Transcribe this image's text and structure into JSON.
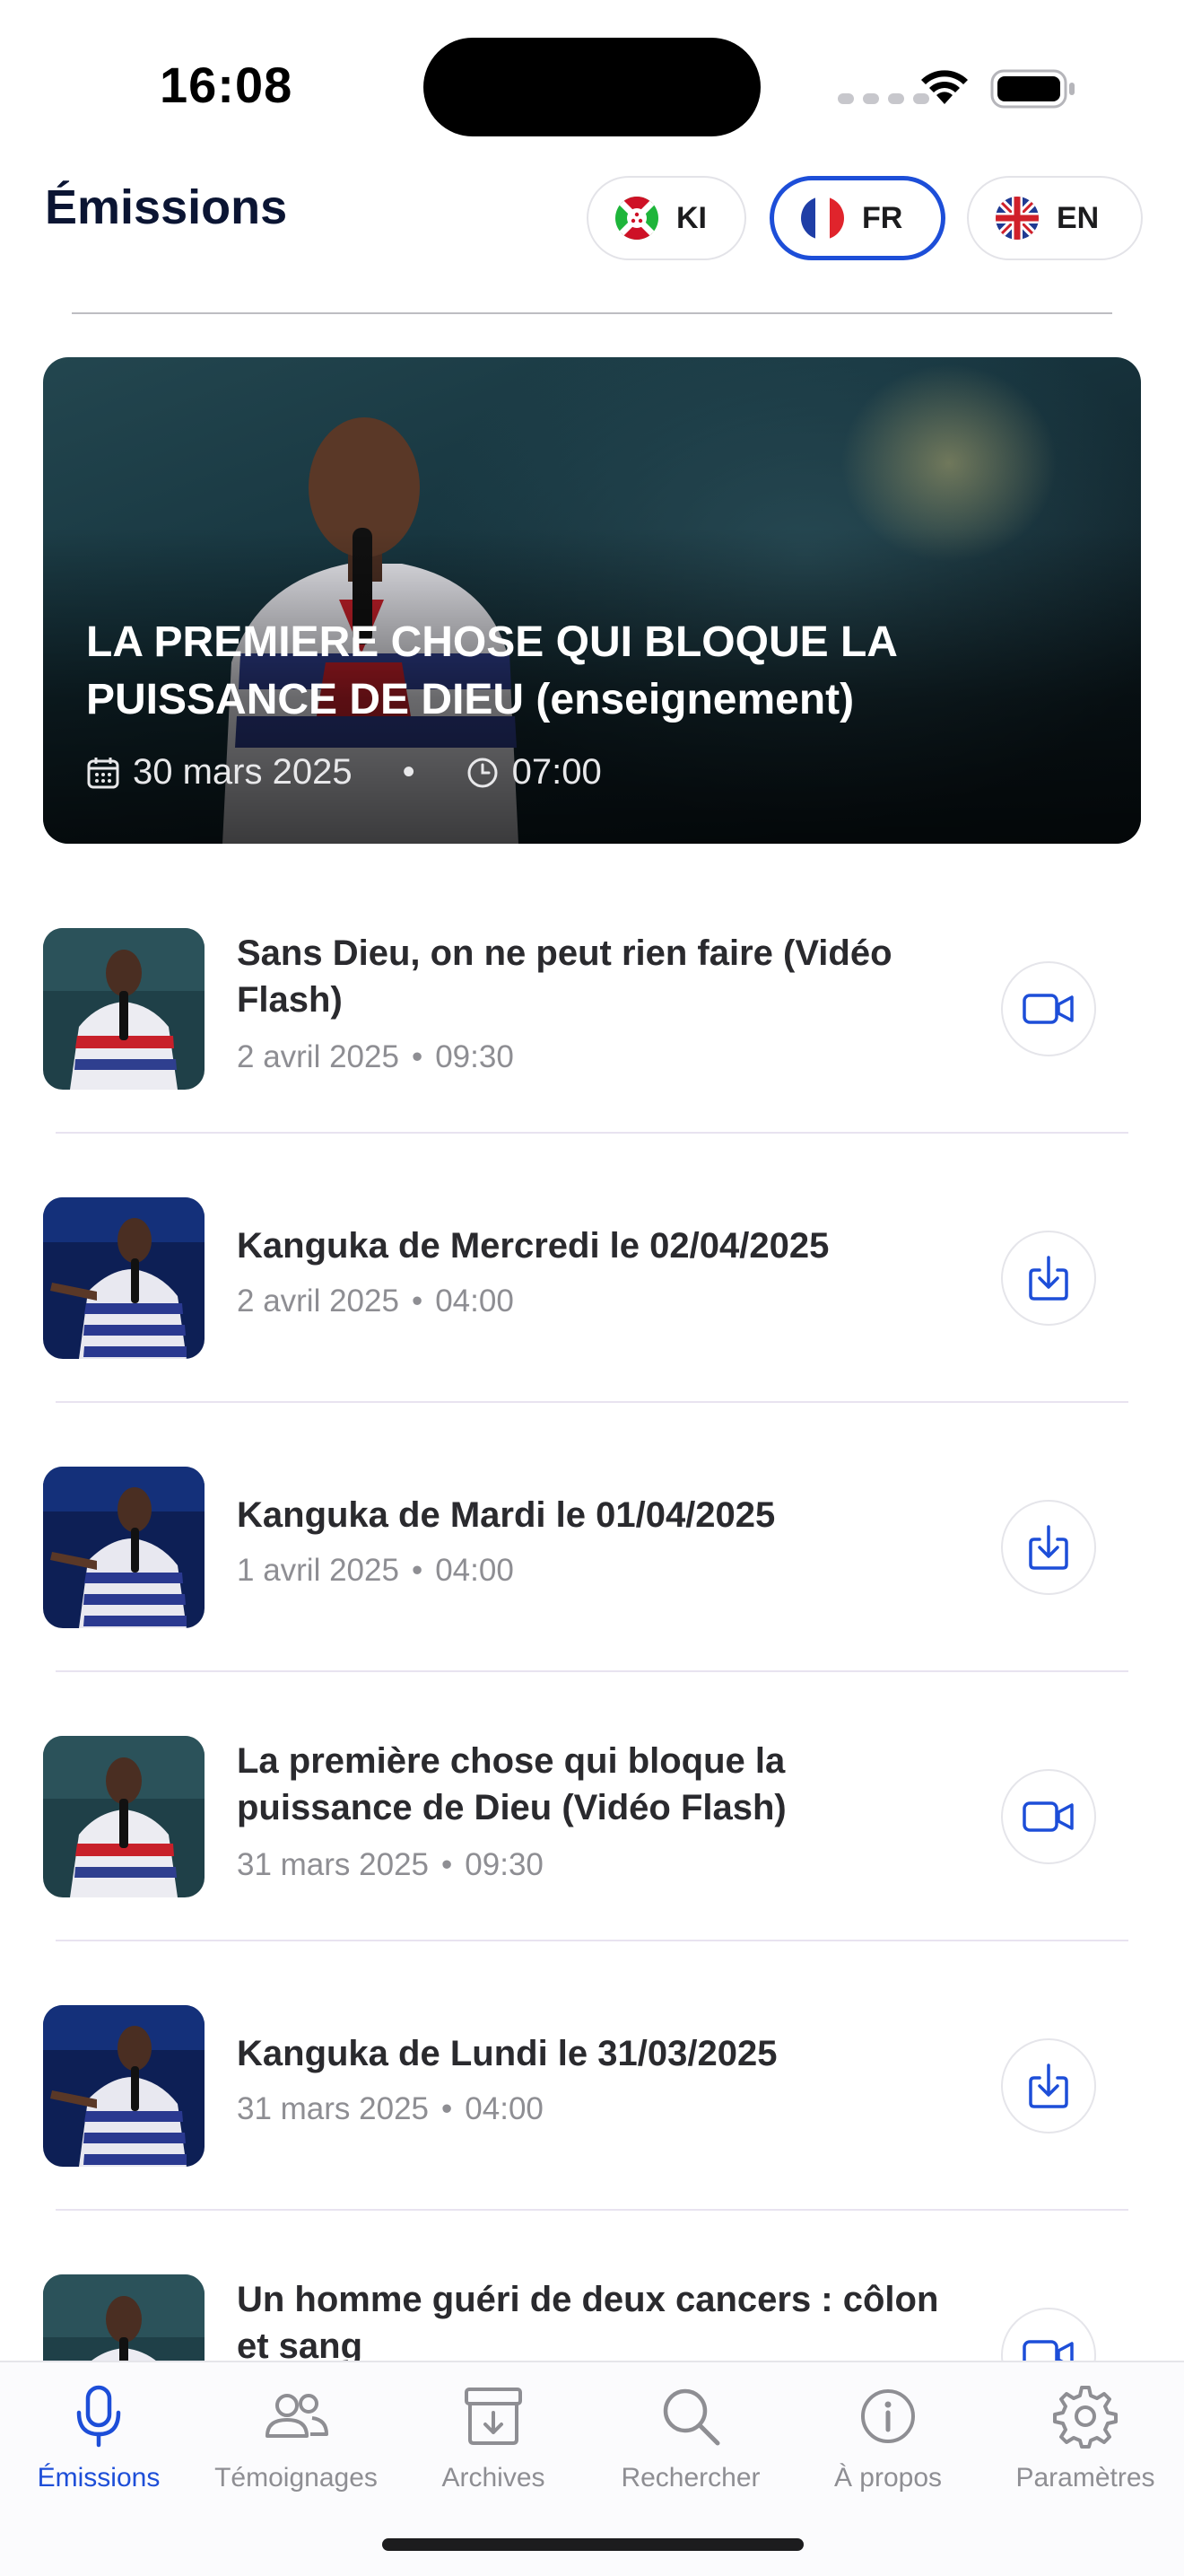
{
  "status_bar": {
    "time": "16:08"
  },
  "header": {
    "title": "Émissions",
    "languages": [
      {
        "code": "KI",
        "flag": "burundi-flag",
        "active": false
      },
      {
        "code": "FR",
        "flag": "france-flag",
        "active": true
      },
      {
        "code": "EN",
        "flag": "uk-flag",
        "active": false
      }
    ]
  },
  "hero": {
    "title": "LA PREMIERE CHOSE QUI BLOQUE LA PUISSANCE DE DIEU (enseignement)",
    "date": "30 mars 2025",
    "time": "07:00"
  },
  "episodes": [
    {
      "title": "Sans Dieu, on ne peut rien faire (Vidéo Flash)",
      "date": "2 avril 2025",
      "time": "09:30",
      "action": "video-icon"
    },
    {
      "title": "Kanguka de Mercredi le 02/04/2025",
      "date": "2 avril 2025",
      "time": "04:00",
      "action": "download-icon"
    },
    {
      "title": "Kanguka de Mardi le 01/04/2025",
      "date": "1 avril 2025",
      "time": "04:00",
      "action": "download-icon"
    },
    {
      "title": "La première chose qui bloque la puissance de Dieu (Vidéo Flash)",
      "date": "31 mars 2025",
      "time": "09:30",
      "action": "video-icon"
    },
    {
      "title": "Kanguka de Lundi le 31/03/2025",
      "date": "31 mars 2025",
      "time": "04:00",
      "action": "download-icon"
    },
    {
      "title": "Un homme guéri de deux cancers : côlon et sang",
      "date": "",
      "time": "",
      "action": "video-icon"
    }
  ],
  "meta_separator": "•",
  "tabs": [
    {
      "label": "Émissions",
      "icon": "microphone-icon",
      "active": true
    },
    {
      "label": "Témoignages",
      "icon": "people-icon",
      "active": false
    },
    {
      "label": "Archives",
      "icon": "archive-box-icon",
      "active": false
    },
    {
      "label": "Rechercher",
      "icon": "search-icon",
      "active": false
    },
    {
      "label": "À propos",
      "icon": "info-icon",
      "active": false
    },
    {
      "label": "Paramètres",
      "icon": "gear-icon",
      "active": false
    }
  ],
  "colors": {
    "accent": "#1d4ed8",
    "muted": "#8e8e93",
    "title": "#0b1533"
  }
}
